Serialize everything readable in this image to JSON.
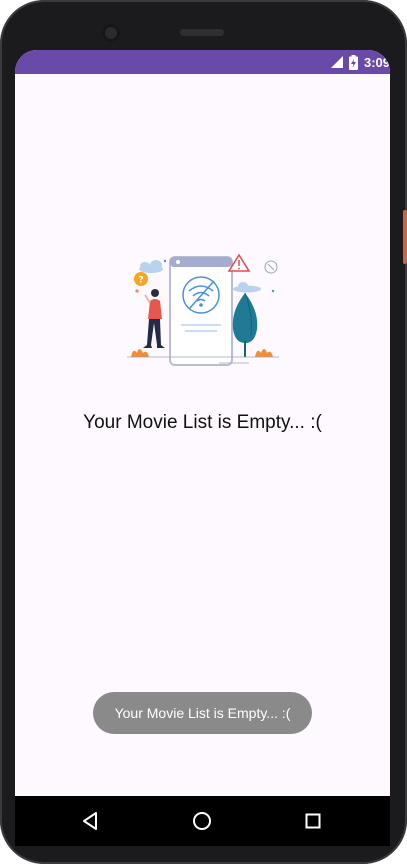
{
  "status_bar": {
    "time": "3:09",
    "icons": [
      "signal-icon",
      "battery-icon"
    ]
  },
  "main": {
    "illustration": "no-connection-illustration",
    "empty_message": "Your Movie List is Empty... :("
  },
  "toast": {
    "message": "Your Movie List is Empty... :("
  },
  "nav_bar": {
    "buttons": [
      "back-icon",
      "home-icon",
      "recents-icon"
    ]
  },
  "colors": {
    "status_bar": "#6a4aa8",
    "background": "#fef9fe",
    "toast": "#8a8a8a",
    "accent_blue": "#4a90e2",
    "accent_orange": "#f28c38"
  }
}
